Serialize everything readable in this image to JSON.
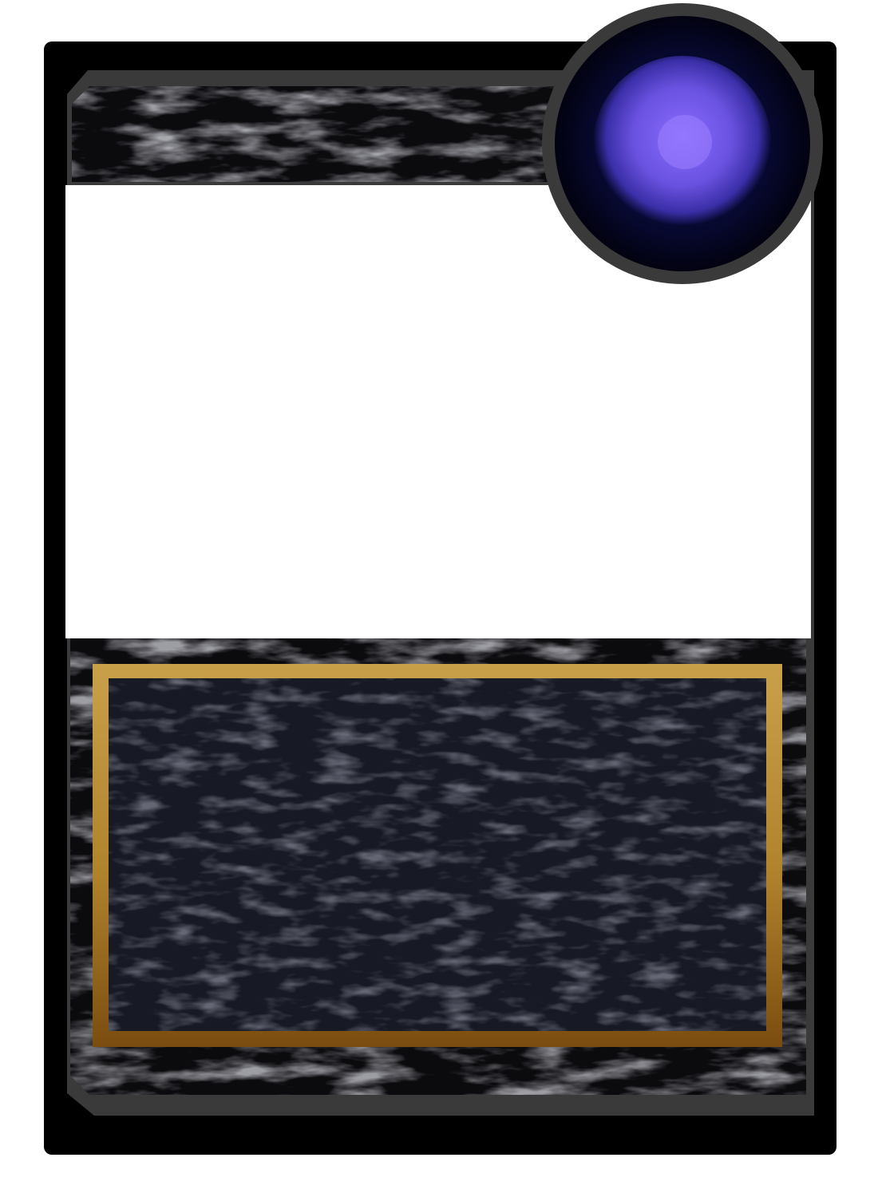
{
  "card": {
    "kind": "blank-card-frame-template",
    "text": {
      "title": "",
      "description": ""
    },
    "colors": {
      "page_background": "#ffffff",
      "outer_border": "#000000",
      "inner_bevel": "#3c3c3c",
      "marble_dark": "#0b0b0e",
      "marble_vein": "#9a9aa6",
      "art_window": "#ffffff",
      "text_box_fill": "#171a25",
      "text_box_gold_light": "#c9a04a",
      "text_box_gold_dark": "#7a4d10",
      "gem_dark": "#070824",
      "gem_glow_center": "#8a6cff",
      "gem_glow_edge": "#3b2fa8"
    },
    "icons": {
      "corner_gem": "purple-orb-icon"
    }
  }
}
